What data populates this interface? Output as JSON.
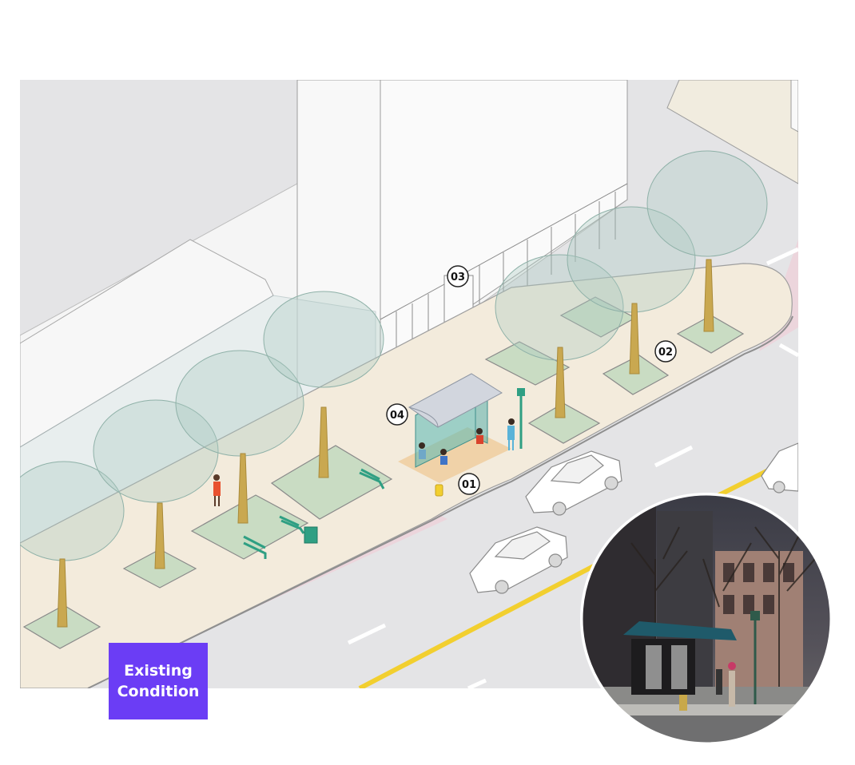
{
  "callouts": {
    "c01": "01",
    "c02": "02",
    "c03": "03",
    "c04": "04"
  },
  "badge": {
    "line1": "Existing",
    "line2": "Condition",
    "color": "#6b3df5"
  },
  "colors": {
    "road": "#e4e4e6",
    "sidewalk": "#f3ebdc",
    "bike_lane": "#ecd5dc",
    "center_line": "#f2cf2f",
    "tree_canopy": "#a9c9bf",
    "planter": "#c9dcc3",
    "shelter": "#55b8b4",
    "building": "#f5f5f5"
  },
  "photo": {
    "subject": "existing bus shelter street photo"
  }
}
